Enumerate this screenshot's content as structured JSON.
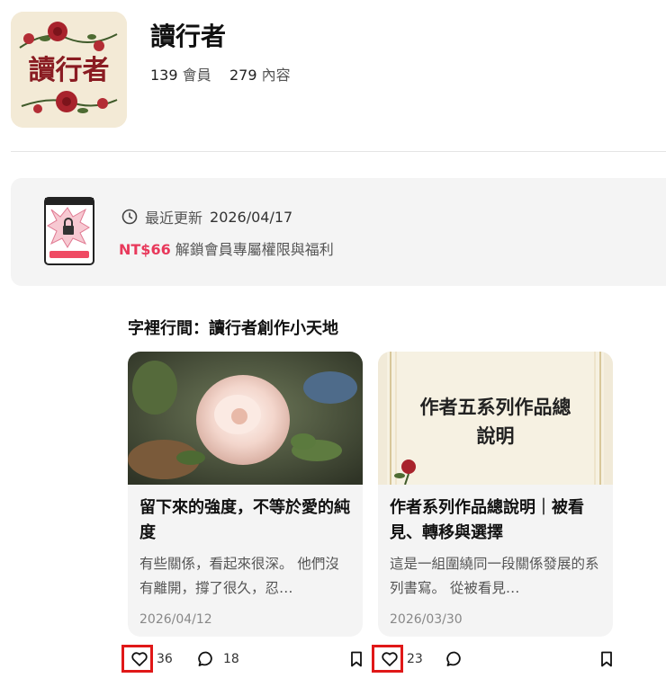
{
  "header": {
    "title": "讀行者",
    "logo_text": "讀行者",
    "member_count": "139",
    "member_label": "會員",
    "content_count": "279",
    "content_label": "內容"
  },
  "promo": {
    "update_label": "最近更新",
    "update_date": "2026/04/17",
    "price": "NT$66",
    "unlock_text": "解鎖會員專屬權限與福利"
  },
  "section_title": "字裡行間：讀行者創作小天地",
  "cards": [
    {
      "title": "留下來的強度，不等於愛的純度",
      "excerpt": "有些關係，看起來很深。 他們沒有離開，撐了很久，忍…",
      "date": "2026/04/12",
      "likes": "36",
      "comments": "18"
    },
    {
      "image_text": "作者五系列作品總說明",
      "title": "作者系列作品總說明｜被看見、轉移與選擇",
      "excerpt": "這是一組圍繞同一段關係發展的系列書寫。 從被看見…",
      "date": "2026/03/30",
      "likes": "23",
      "comments": ""
    }
  ],
  "colors": {
    "accent": "#e8395b",
    "highlight_box": "#e01818"
  }
}
